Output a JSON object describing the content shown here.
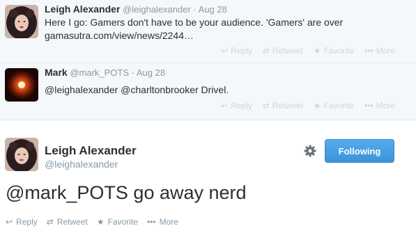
{
  "tweets": [
    {
      "fullname": "Leigh Alexander",
      "screen_name": "@leighalexander",
      "date": "· Aug 28",
      "text": "Here I go: Gamers don't have to be your audience. 'Gamers' are over",
      "link": "gamasutra.com/view/news/2244…",
      "avatar_icon": "profile-photo-woman"
    },
    {
      "fullname": "Mark",
      "screen_name": "@mark_POTS",
      "date": "· Aug 28",
      "text": "@leighalexander @charltonbrooker Drivel.",
      "avatar_icon": "red-eye-orb"
    }
  ],
  "actions": {
    "reply": "Reply",
    "retweet": "Retweet",
    "favorite": "Favorite",
    "more": "More"
  },
  "permalink": {
    "fullname": "Leigh Alexander",
    "screen_name": "@leighalexander",
    "text": "@mark_POTS go away nerd",
    "follow_label": "Following",
    "gear_icon": "gear-icon"
  },
  "colors": {
    "follow_button": "#3b94d9",
    "muted": "#8899a6",
    "faded_actions": "#ccd6dd",
    "reply_bg": "#f5f8fa"
  }
}
